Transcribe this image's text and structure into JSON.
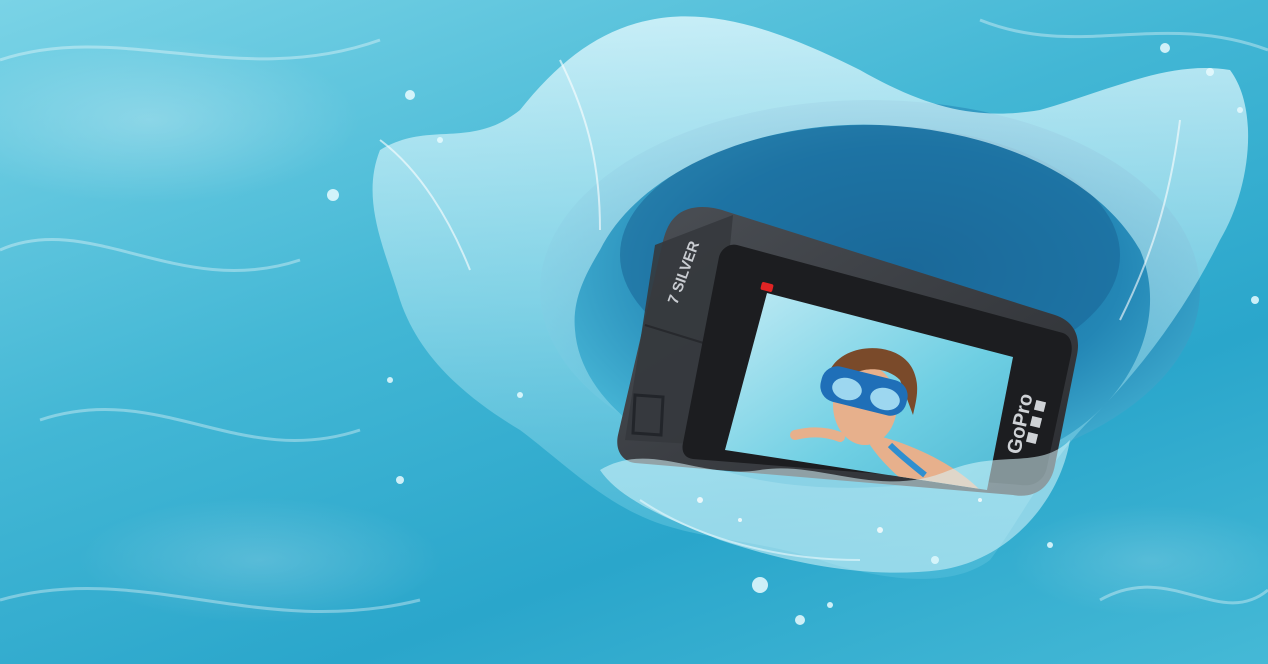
{
  "photo": {
    "subject": "action-camera-splashing-in-water",
    "camera_model_label": "7 SILVER",
    "camera_brand_label": "GoPro",
    "colors": {
      "water_light": "#8ddcec",
      "water_mid": "#3fb6d3",
      "water_deep": "#1f8fb7",
      "camera_body": "#3a3d42",
      "camera_shell": "#2a2c30",
      "record_light": "#e02424",
      "screen_water": "#7fd3e6",
      "mask_blue": "#1f6fb8"
    }
  }
}
